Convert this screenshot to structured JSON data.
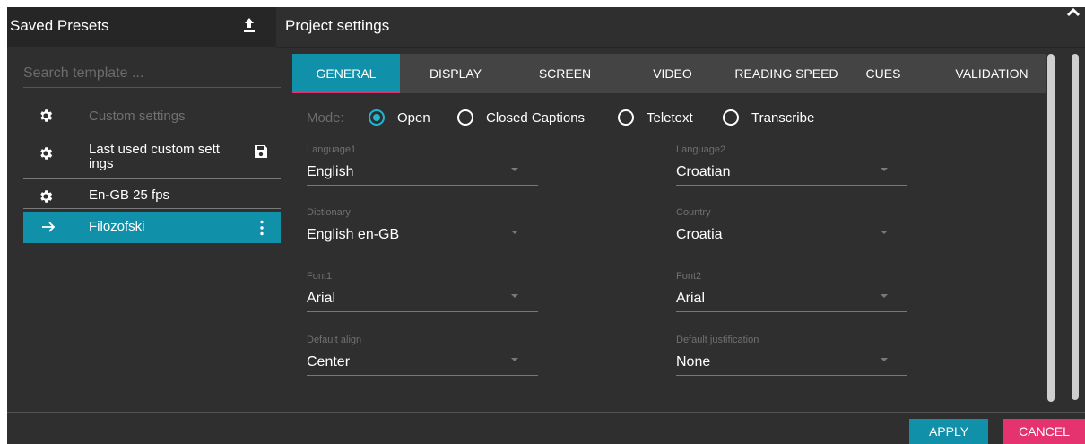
{
  "left_panel": {
    "title": "Saved Presets",
    "upload_icon": "upload-icon",
    "search": {
      "placeholder": "Search template ...",
      "value": ""
    },
    "presets": [
      {
        "label": "Custom settings",
        "icon": "gear-icon",
        "disabled": true
      },
      {
        "label": "Last used custom sett ings",
        "icon": "gear-icon",
        "action_icon": "save-icon"
      },
      {
        "label": "En-GB 25 fps",
        "icon": "gear-icon"
      },
      {
        "label": "Filozofski",
        "icon": "arrow-right-icon",
        "action_icon": "more-vert-icon",
        "selected": true
      }
    ]
  },
  "right_panel": {
    "title": "Project settings",
    "close_icon": "close-icon",
    "tabs": [
      {
        "label": "GENERAL",
        "active": true
      },
      {
        "label": "DISPLAY"
      },
      {
        "label": "SCREEN"
      },
      {
        "label": "VIDEO"
      },
      {
        "label": "READING SPEED"
      },
      {
        "label": "CUES"
      },
      {
        "label": "VALIDATION"
      }
    ],
    "mode": {
      "label": "Mode:",
      "options": [
        "Open",
        "Closed Captions",
        "Teletext",
        "Transcribe"
      ],
      "selected": "Open"
    },
    "fields": {
      "language1": {
        "label": "Language1",
        "value": "English"
      },
      "language2": {
        "label": "Language2",
        "value": "Croatian"
      },
      "dictionary": {
        "label": "Dictionary",
        "value": "English en-GB"
      },
      "country": {
        "label": "Country",
        "value": "Croatia"
      },
      "font1": {
        "label": "Font1",
        "value": "Arial"
      },
      "font2": {
        "label": "Font2",
        "value": "Arial"
      },
      "default_align": {
        "label": "Default align",
        "value": "Center"
      },
      "default_justification": {
        "label": "Default justification",
        "value": "None"
      }
    }
  },
  "footer": {
    "apply_label": "APPLY",
    "cancel_label": "CANCEL"
  },
  "colors": {
    "background": "#2f2f2f",
    "header": "#262626",
    "accent": "#1190a9",
    "radio_accent": "#1eb6d3",
    "danger": "#e4336f",
    "tab_strip": "#444444"
  }
}
